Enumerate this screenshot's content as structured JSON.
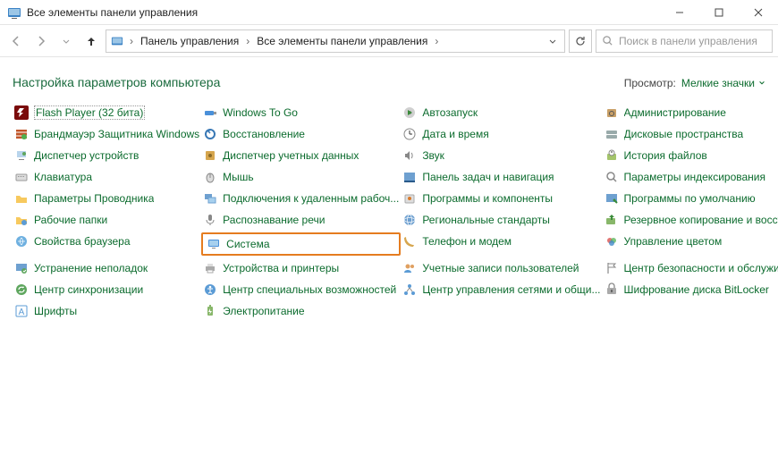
{
  "window": {
    "title": "Все элементы панели управления"
  },
  "breadcrumb": {
    "root": "Панель управления",
    "current": "Все элементы панели управления"
  },
  "search": {
    "placeholder": "Поиск в панели управления"
  },
  "header": {
    "title": "Настройка параметров компьютера",
    "view_label": "Просмотр:",
    "view_value": "Мелкие значки"
  },
  "items": {
    "c0": [
      "Flash Player (32 бита)",
      "Брандмауэр Защитника Windows",
      "Диспетчер устройств",
      "Клавиатура",
      "Параметры Проводника",
      "Рабочие папки",
      "Свойства браузера",
      "Устранение неполадок",
      "Центр синхронизации",
      "Шрифты"
    ],
    "c1": [
      "Windows To Go",
      "Восстановление",
      "Диспетчер учетных данных",
      "Мышь",
      "Подключения к удаленным рабоч...",
      "Распознавание речи",
      "Система",
      "Устройства и принтеры",
      "Центр специальных возможностей",
      "Электропитание"
    ],
    "c2": [
      "Автозапуск",
      "Дата и время",
      "Звук",
      "Панель задач и навигация",
      "Программы и компоненты",
      "Региональные стандарты",
      "Телефон и модем",
      "Учетные записи пользователей",
      "Центр управления сетями и общи..."
    ],
    "c3": [
      "Администрирование",
      "Дисковые пространства",
      "История файлов",
      "Параметры индексирования",
      "Программы по умолчанию",
      "Резервное копирование и восстан...",
      "Управление цветом",
      "Центр безопасности и обслужив...",
      "Шифрование диска BitLocker"
    ]
  }
}
